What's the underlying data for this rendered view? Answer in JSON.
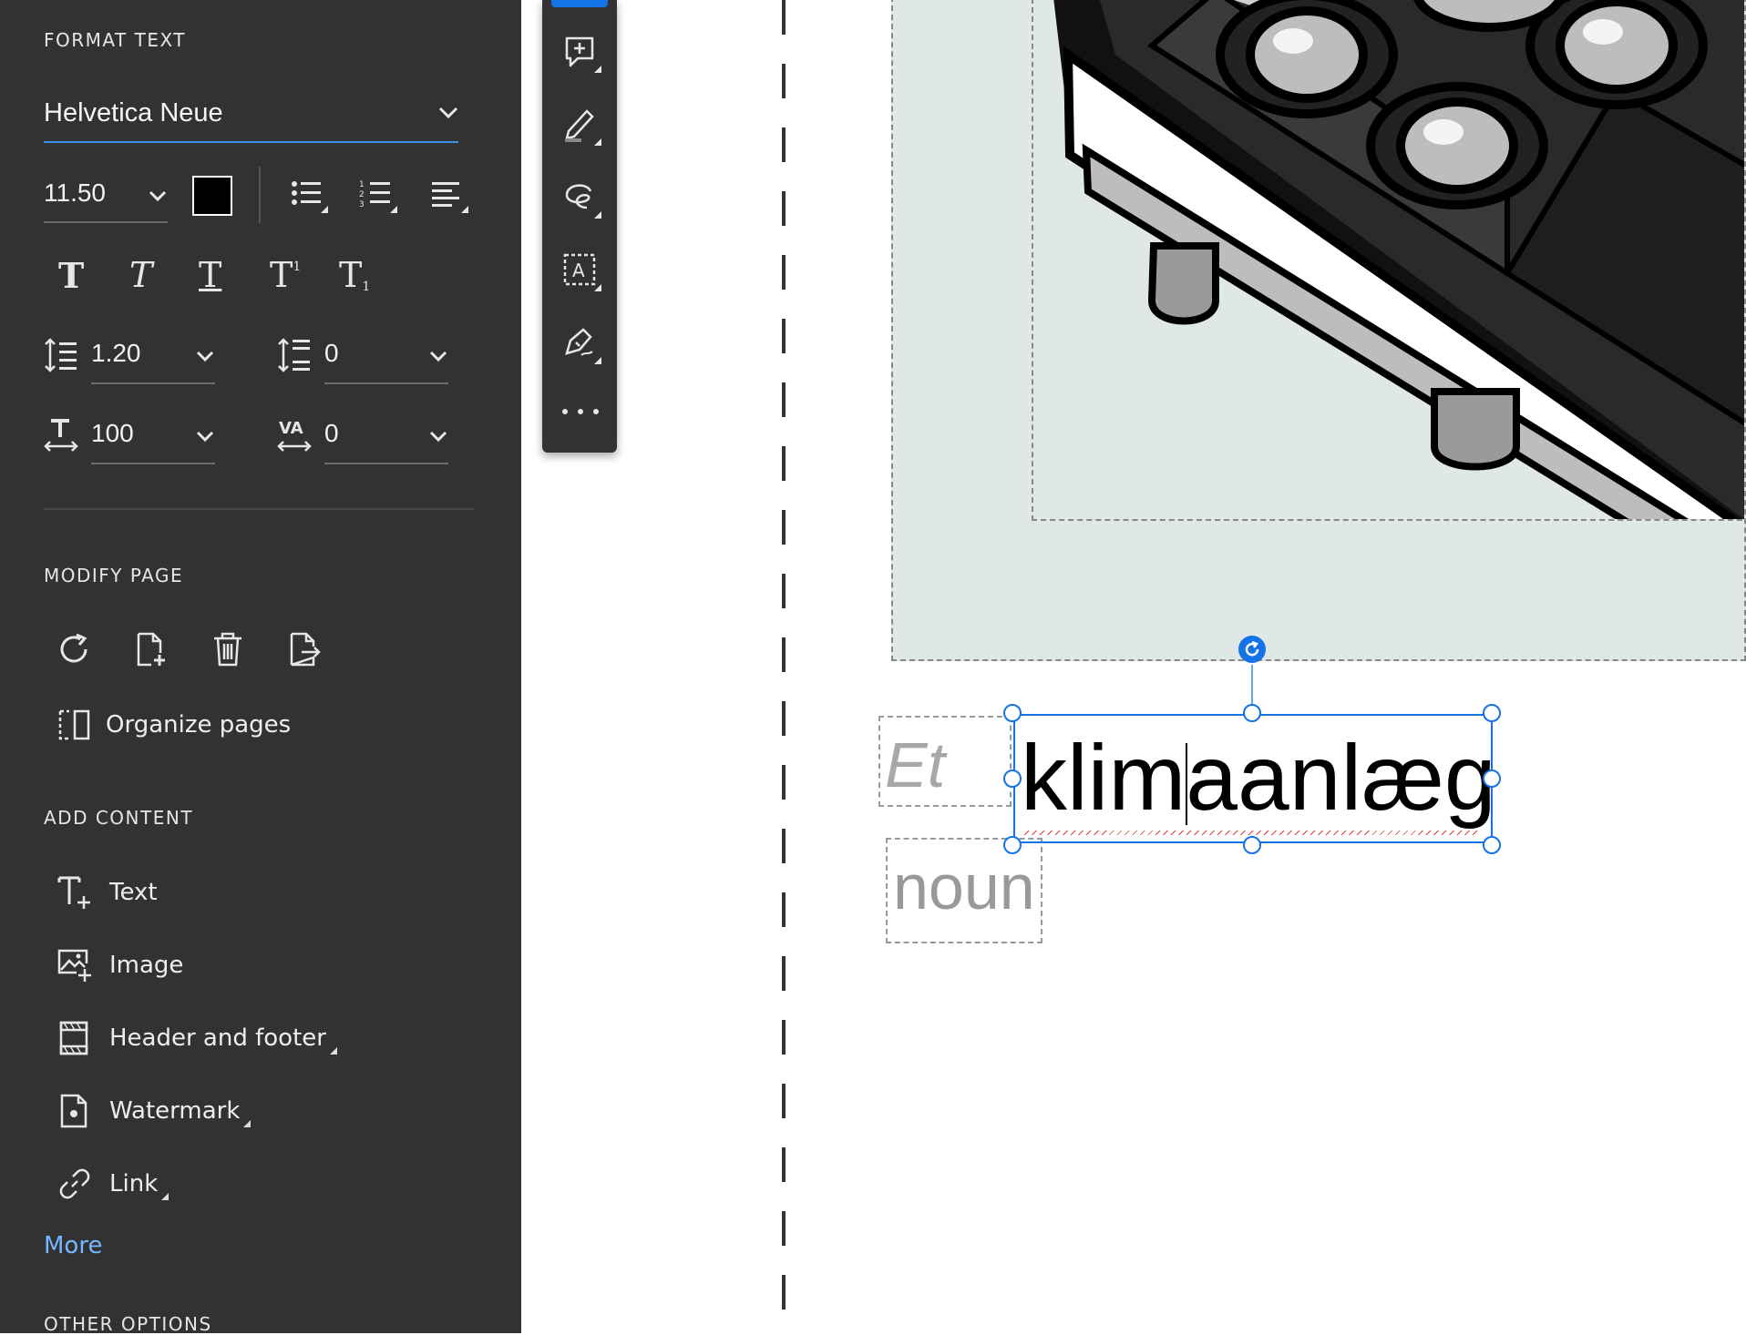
{
  "format_text": {
    "title": "FORMAT TEXT",
    "font_family": "Helvetica Neue",
    "font_size": "11.50",
    "text_color": "#000000",
    "line_spacing": "1.20",
    "paragraph_spacing": "0",
    "horizontal_scale": "100",
    "char_spacing": "0",
    "style_buttons": [
      "bold-icon",
      "italic-icon",
      "underline-icon",
      "superscript-icon",
      "subscript-icon"
    ]
  },
  "modify_page": {
    "title": "MODIFY PAGE",
    "organize_label": "Organize pages"
  },
  "add_content": {
    "title": "ADD CONTENT",
    "items": [
      {
        "label": "Text",
        "icon": "add-text-icon"
      },
      {
        "label": "Image",
        "icon": "add-image-icon"
      },
      {
        "label": "Header and footer",
        "icon": "header-footer-icon"
      },
      {
        "label": "Watermark",
        "icon": "watermark-icon"
      },
      {
        "label": "Link",
        "icon": "link-icon"
      }
    ],
    "more_label": "More"
  },
  "other_options": {
    "title": "OTHER OPTIONS"
  },
  "canvas": {
    "article": "Et",
    "word": "klimaanlæg",
    "pos": "noun"
  },
  "colors": {
    "panel_bg": "#323232",
    "accent": "#1473e6",
    "link": "#75b6ff"
  }
}
